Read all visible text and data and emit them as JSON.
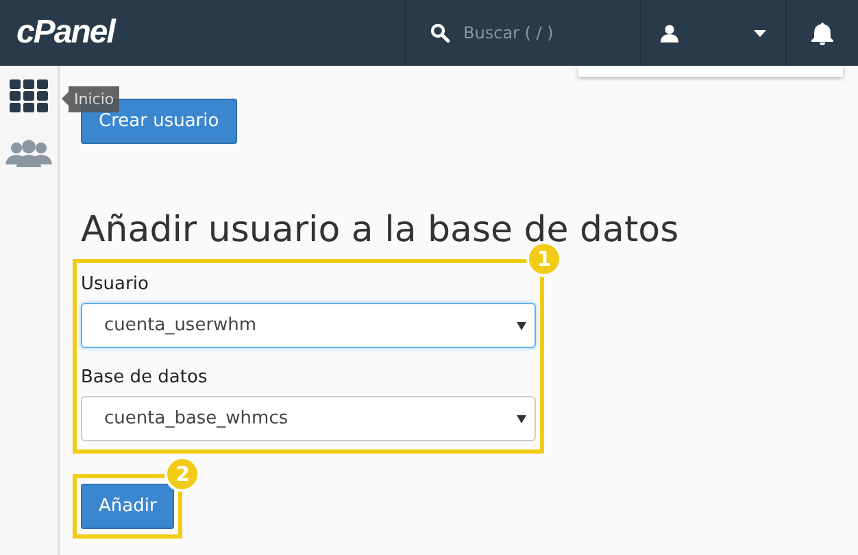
{
  "topbar": {
    "logo": "cPanel",
    "search": {
      "placeholder": "Buscar ( / )"
    }
  },
  "sidebar": {
    "items": [
      {
        "kind": "grid",
        "tooltip": "Inicio"
      },
      {
        "kind": "users"
      }
    ]
  },
  "create_button": "Crear usuario",
  "heading": "Añadir usuario a la base de datos",
  "form": {
    "callout": "1",
    "fields": [
      {
        "label": "Usuario",
        "value": "cuenta_userwhm",
        "focused": true
      },
      {
        "label": "Base de datos",
        "value": "cuenta_base_whmcs",
        "focused": false
      }
    ]
  },
  "submit": {
    "label": "Añadir",
    "callout": "2"
  }
}
